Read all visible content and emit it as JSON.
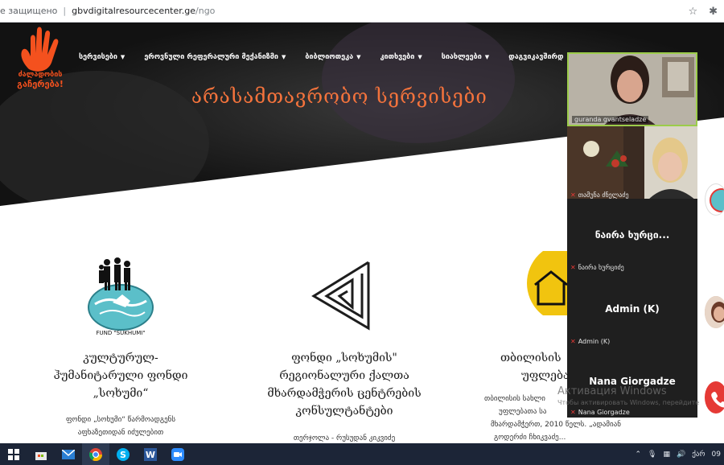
{
  "browser": {
    "security_text": "е защищено",
    "url_host": "gbvdigitalresourcecenter.ge",
    "url_path": "/ngo"
  },
  "site": {
    "logo_text_line1": "ძალადობის",
    "logo_text_line2": "გაჩერება!",
    "nav": [
      {
        "label": "სერვისები"
      },
      {
        "label": "ეროვნული რეფერალური მექანიზმი"
      },
      {
        "label": "ბიბლიოთეკა"
      },
      {
        "label": "კითხვები"
      },
      {
        "label": "სიახლეები"
      },
      {
        "label": "დაგვიკავშირდ"
      }
    ],
    "hero_title": "არასამთავრობო სერვისები",
    "accent_color": "#f4733c"
  },
  "cards": [
    {
      "title_lines": [
        "კულტურულ-",
        "ჰუმანიტარული ფონდი",
        "„სოხუმი“"
      ],
      "text_lines": [
        "ფონდი „სოხუმი“ წარმოადგენს",
        "აფხაზეთიდან იძულებით"
      ],
      "logo_caption": "FUND \"SUKHUMI\""
    },
    {
      "title_lines": [
        "ფონდი „სოხუმის\"",
        "რეგიონალური ქალთა",
        "მხარდამჭერის ცენტრების",
        "კონსულტანტები"
      ],
      "text_lines": [
        "თერჯოლა - რუსუდან კიკვიძე"
      ]
    },
    {
      "title_lines": [
        "თბილისის",
        "უფლებათ"
      ],
      "text_lines": [
        "თბილისის სახლი",
        "უფლებათა სა",
        "მხარდამჭერთ, 2010 წელს. „ადამიან",
        "გოდერძი ჩხიკვაძე..."
      ]
    }
  ],
  "video_panel": {
    "participants": [
      {
        "name": "guranda gvantseladze",
        "muted": false,
        "video": true
      },
      {
        "name": "თამუნა ძნელაძე",
        "muted": true,
        "video": true
      },
      {
        "display": "ნაირა ხურცი...",
        "name": "ნაირა ხურციძე",
        "muted": true,
        "video": false
      },
      {
        "display": "Admin (K)",
        "name": "Admin (K)",
        "muted": true,
        "video": false
      },
      {
        "display": "Nana Giorgadze",
        "name": "Nana Giorgadze",
        "muted": true,
        "video": false
      }
    ]
  },
  "windows_activation": {
    "title": "Активация Windows",
    "subtitle": "Чтобы активировать Windows, перейдите"
  },
  "taskbar": {
    "tray_lang": "ქარ",
    "tray_time": "09"
  }
}
